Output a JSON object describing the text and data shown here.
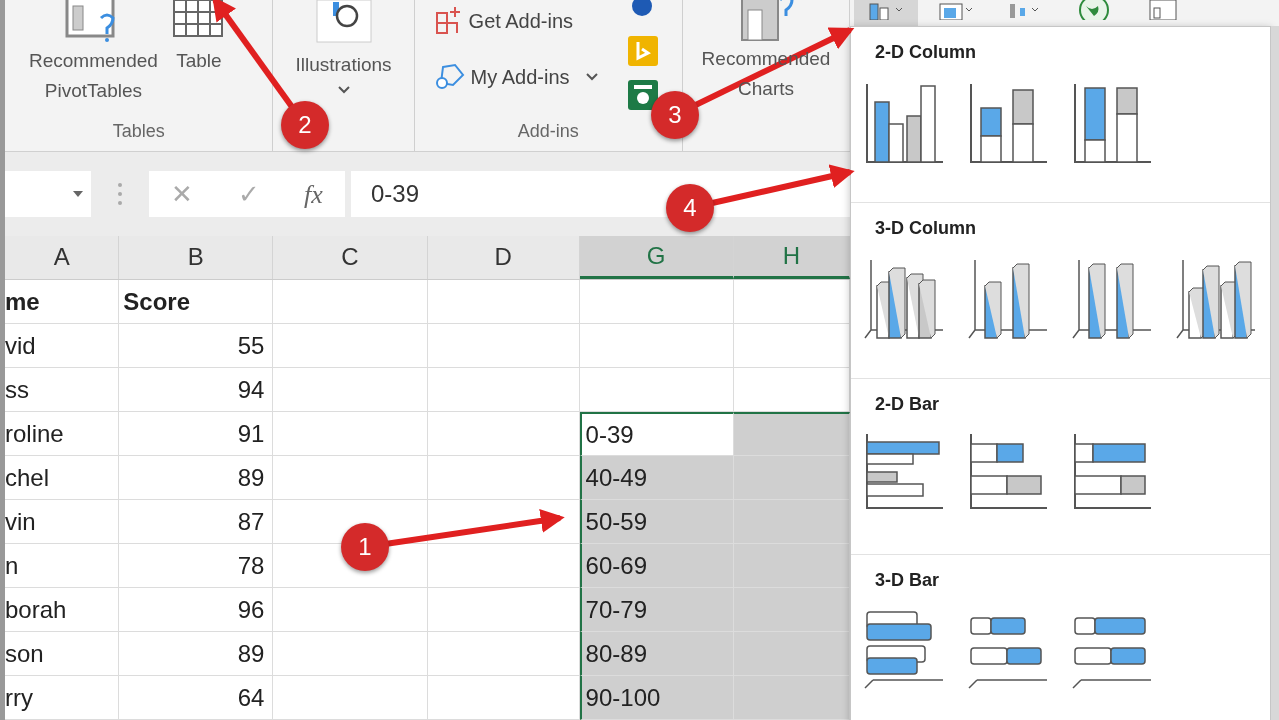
{
  "ribbon": {
    "groups": [
      {
        "kind": "tables",
        "label": "Tables",
        "buttons": [
          {
            "kind": "pivot",
            "lines": [
              "Recommended",
              "PivotTables"
            ]
          },
          {
            "kind": "table",
            "lines": [
              "Table"
            ]
          }
        ]
      },
      {
        "kind": "illustrations",
        "buttons": [
          {
            "kind": "illustrations",
            "lines": [
              "Illustrations"
            ]
          }
        ]
      },
      {
        "kind": "addins",
        "label": "Add-ins",
        "buttons": [
          {
            "kind": "get",
            "lines": [
              "Get Add-ins"
            ]
          },
          {
            "kind": "my",
            "lines": [
              "My Add-ins"
            ]
          }
        ]
      },
      {
        "kind": "charts",
        "buttons": [
          {
            "kind": "recommended",
            "lines": [
              "Recommended",
              "Charts"
            ]
          }
        ]
      }
    ],
    "chart_buttons": [
      {
        "kind": "column",
        "selected": true
      },
      {
        "kind": "hierarchy",
        "selected": false
      },
      {
        "kind": "waterfall",
        "selected": false
      },
      {
        "kind": "map",
        "selected": false
      },
      {
        "kind": "pivotchart",
        "selected": false
      }
    ]
  },
  "formula_bar": {
    "cancel": "✕",
    "enter": "✓",
    "function": "fx",
    "value": "0-39"
  },
  "sheet": {
    "columns": [
      {
        "label": "A",
        "selected": false
      },
      {
        "label": "B",
        "selected": false
      },
      {
        "label": "C",
        "selected": false
      },
      {
        "label": "D",
        "selected": false
      },
      {
        "label": "G",
        "selected": true
      },
      {
        "label": "H",
        "selected": true
      }
    ],
    "rows": [
      {
        "kind": "header",
        "name": "me",
        "score": "Score",
        "bucket": "",
        "selected": false,
        "active": false
      },
      {
        "kind": "data",
        "name": "vid",
        "score": "55",
        "bucket": "",
        "selected": false,
        "active": false
      },
      {
        "kind": "data",
        "name": "ss",
        "score": "94",
        "bucket": "",
        "selected": false,
        "active": false
      },
      {
        "kind": "data",
        "name": "roline",
        "score": "91",
        "bucket": "0-39",
        "selected": true,
        "active": true
      },
      {
        "kind": "data",
        "name": "chel",
        "score": "89",
        "bucket": "40-49",
        "selected": true,
        "active": false
      },
      {
        "kind": "data",
        "name": "vin",
        "score": "87",
        "bucket": "50-59",
        "selected": true,
        "active": false
      },
      {
        "kind": "data",
        "name": "n",
        "score": "78",
        "bucket": "60-69",
        "selected": true,
        "active": false
      },
      {
        "kind": "data",
        "name": "borah",
        "score": "96",
        "bucket": "70-79",
        "selected": true,
        "active": false
      },
      {
        "kind": "data",
        "name": "son",
        "score": "89",
        "bucket": "80-89",
        "selected": true,
        "active": false
      },
      {
        "kind": "data",
        "name": "rry",
        "score": "64",
        "bucket": "90-100",
        "selected": true,
        "active": false
      }
    ]
  },
  "chart_menu": {
    "sections": [
      {
        "title": "2-D Column",
        "items": [
          {
            "kind": "col-clustered"
          },
          {
            "kind": "col-stacked"
          },
          {
            "kind": "col-percent"
          }
        ]
      },
      {
        "title": "3-D Column",
        "items": [
          {
            "kind": "col3d-clustered"
          },
          {
            "kind": "col3d-stacked"
          },
          {
            "kind": "col3d-percent"
          },
          {
            "kind": "col3d"
          }
        ]
      },
      {
        "title": "2-D Bar",
        "items": [
          {
            "kind": "bar-clustered"
          },
          {
            "kind": "bar-stacked"
          },
          {
            "kind": "bar-percent"
          }
        ]
      },
      {
        "title": "3-D Bar",
        "items": [
          {
            "kind": "bar3d-clustered"
          },
          {
            "kind": "bar3d-stacked"
          },
          {
            "kind": "bar3d-percent"
          }
        ]
      }
    ]
  },
  "annotations": [
    {
      "label": "1"
    },
    {
      "label": "2"
    },
    {
      "label": "3"
    },
    {
      "label": "4"
    }
  ]
}
